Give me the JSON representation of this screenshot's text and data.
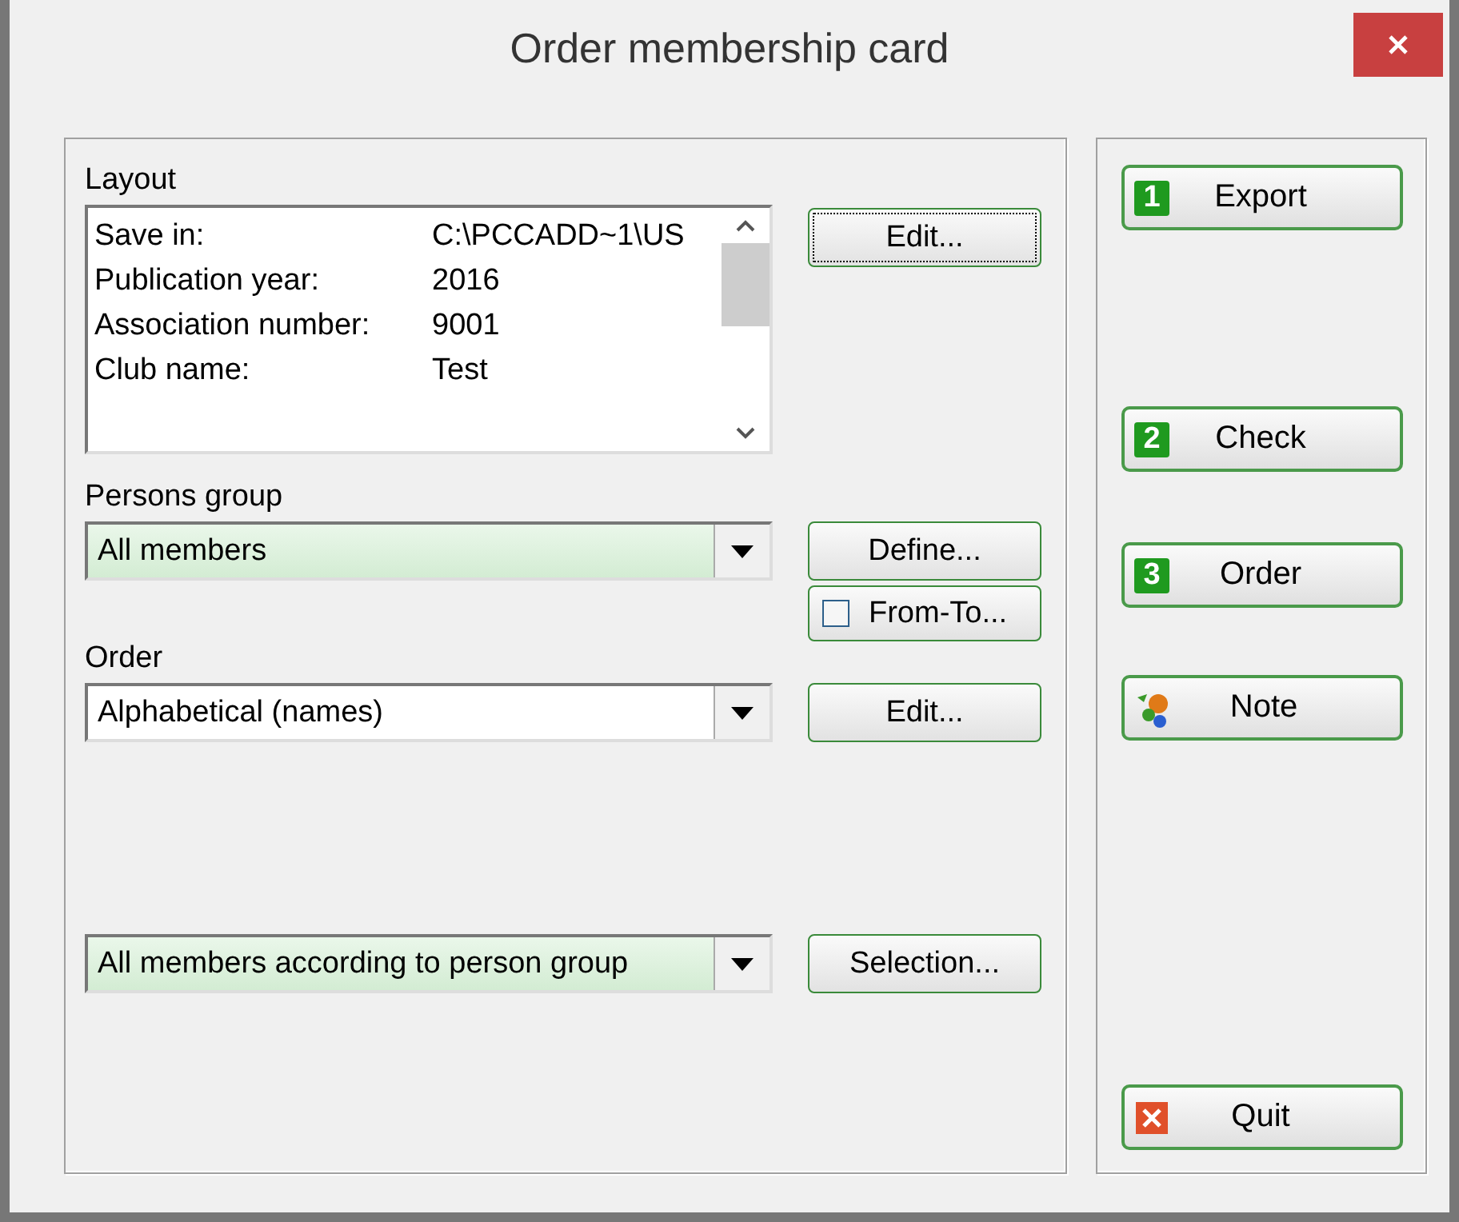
{
  "window": {
    "title": "Order membership card"
  },
  "layout": {
    "label": "Layout",
    "rows": [
      {
        "field": "Save in:",
        "value": "C:\\PCCADD~1\\US"
      },
      {
        "field": "Publication year:",
        "value": "2016"
      },
      {
        "field": "Association number:",
        "value": "9001"
      },
      {
        "field": "Club name:",
        "value": "Test"
      }
    ],
    "button": "Edit..."
  },
  "persons_group": {
    "label": "Persons group",
    "value": "All members",
    "highlighted": true,
    "button": "Define...",
    "from_to": {
      "label": "From-To...",
      "checked": false
    }
  },
  "order": {
    "label": "Order",
    "value": "Alphabetical (names)",
    "highlighted": false,
    "button": "Edit..."
  },
  "selection": {
    "value": "All members according to person group",
    "highlighted": true,
    "button": "Selection..."
  },
  "actions": [
    {
      "kind": "step",
      "badge": "1",
      "label": "Export"
    },
    {
      "kind": "step",
      "badge": "2",
      "label": "Check"
    },
    {
      "kind": "step",
      "badge": "3",
      "label": "Order"
    },
    {
      "kind": "note",
      "label": "Note"
    },
    {
      "kind": "quit",
      "label": "Quit"
    }
  ]
}
